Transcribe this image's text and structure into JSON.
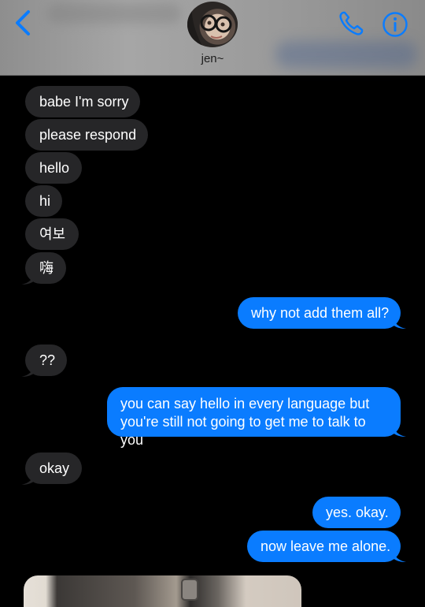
{
  "header": {
    "contact_name": "jen~",
    "icons": {
      "back": "chevron-left-icon",
      "call": "phone-icon",
      "info": "info-icon"
    },
    "accent_color": "#0a7cff"
  },
  "messages": [
    {
      "side": "received",
      "text": "babe I'm sorry"
    },
    {
      "side": "received",
      "text": "please respond"
    },
    {
      "side": "received",
      "text": "hello"
    },
    {
      "side": "received",
      "text": "hi"
    },
    {
      "side": "received",
      "text": "여보"
    },
    {
      "side": "received",
      "text": "嗨"
    },
    {
      "side": "sent",
      "text": "why not add them all?"
    },
    {
      "side": "received",
      "text": "??"
    },
    {
      "side": "sent",
      "text": "you can say hello in every language but you're still not going to get me to talk to you"
    },
    {
      "side": "received",
      "text": "okay"
    },
    {
      "side": "sent",
      "text": "yes. okay."
    },
    {
      "side": "sent",
      "text": "now leave me alone."
    }
  ],
  "colors": {
    "background": "#000000",
    "received_bubble": "#262628",
    "sent_bubble": "#0a7cff",
    "header_bg": "#a0a0a0"
  }
}
